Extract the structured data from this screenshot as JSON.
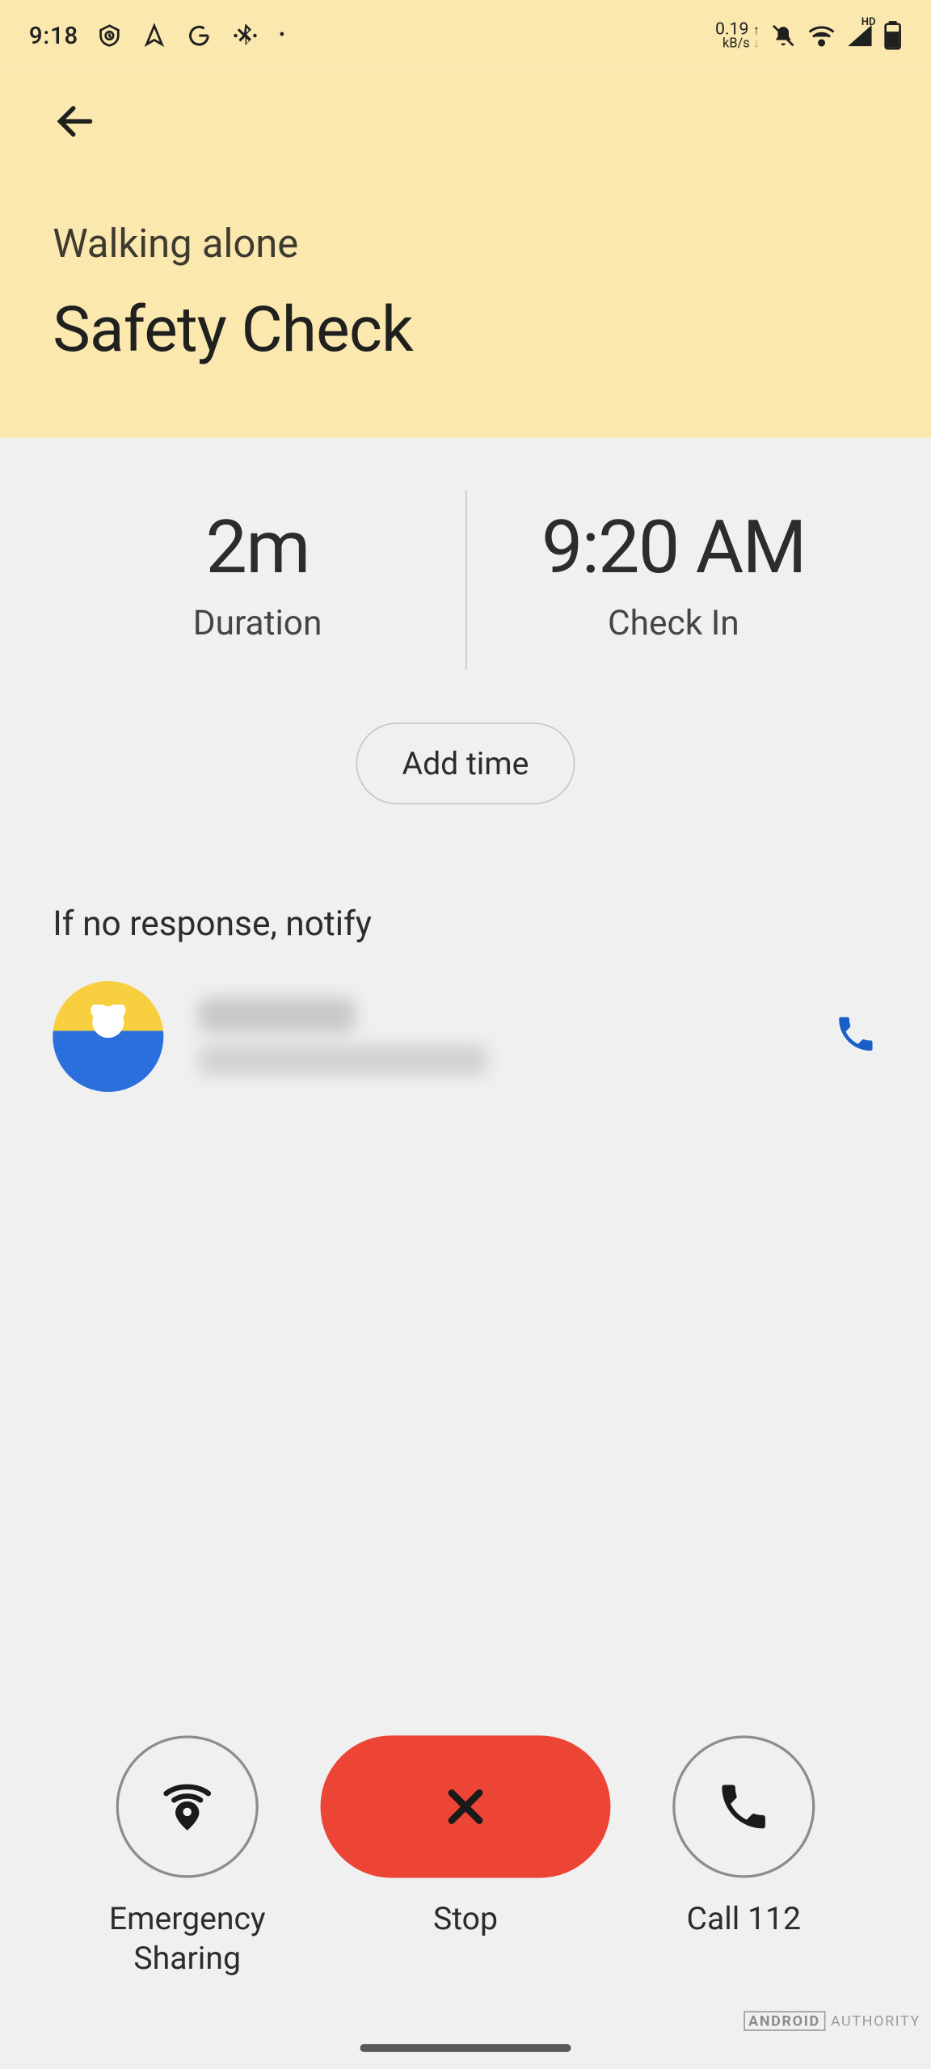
{
  "status": {
    "time": "9:18",
    "net_speed_value": "0.19",
    "net_speed_unit": "kB/s"
  },
  "header": {
    "subtitle": "Walking alone",
    "title": "Safety Check"
  },
  "stats": {
    "duration_value": "2m",
    "duration_label": "Duration",
    "checkin_value": "9:20 AM",
    "checkin_label": "Check In"
  },
  "buttons": {
    "add_time": "Add time"
  },
  "notify_label": "If no response, notify",
  "contact": {
    "name": "",
    "phone": ""
  },
  "actions": {
    "emergency_sharing": "Emergency\nSharing",
    "stop": "Stop",
    "call": "Call 112"
  },
  "watermark": {
    "brand": "ANDROID",
    "site": "AUTHORITY"
  }
}
